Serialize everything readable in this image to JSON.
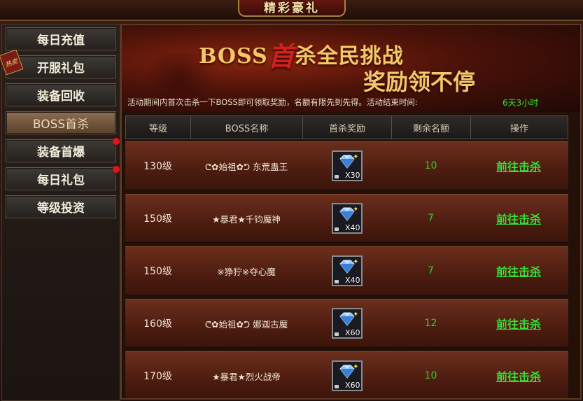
{
  "window": {
    "title": "精彩豪礼"
  },
  "sidebar": {
    "badge": "热卖",
    "items": [
      {
        "label": "每日充值",
        "active": false,
        "dot": false
      },
      {
        "label": "开服礼包",
        "active": false,
        "dot": false
      },
      {
        "label": "装备回收",
        "active": false,
        "dot": false
      },
      {
        "label": "BOSS首杀",
        "active": true,
        "dot": false
      },
      {
        "label": "装备首爆",
        "active": false,
        "dot": true
      },
      {
        "label": "每日礼包",
        "active": false,
        "dot": true
      },
      {
        "label": "等级投资",
        "active": false,
        "dot": false
      }
    ]
  },
  "banner": {
    "headline_a": "BOSS",
    "headline_big": "首",
    "headline_b": "杀全民挑战",
    "headline2": "奖励领不停",
    "notice": "活动期间内首次击杀一下BOSS即可领取奖励，名额有限先到先得。活动结束时间:",
    "time_left": "6天3小时"
  },
  "table": {
    "headers": [
      "等级",
      "BOSS名称",
      "首杀奖励",
      "剩余名额",
      "操作"
    ],
    "rows": [
      {
        "level": "130级",
        "boss": "ᕦ✿始祖✿ᕤ 东荒蛊王",
        "qty": "X30",
        "remaining": "10",
        "action": "前往击杀"
      },
      {
        "level": "150级",
        "boss": "★暴君★千钧魔神",
        "qty": "X40",
        "remaining": "7",
        "action": "前往击杀"
      },
      {
        "level": "150级",
        "boss": "※狰狞※夺心魔",
        "qty": "X40",
        "remaining": "7",
        "action": "前往击杀"
      },
      {
        "level": "160级",
        "boss": "ᕦ✿始祖✿ᕤ 娜迦古魔",
        "qty": "X60",
        "remaining": "12",
        "action": "前往击杀"
      },
      {
        "level": "170级",
        "boss": "★暴君★烈火战帝",
        "qty": "X60",
        "remaining": "10",
        "action": "前往击杀"
      }
    ]
  },
  "icons": {
    "reward": "diamond-icon",
    "lock": "lock-icon",
    "sparkle": "sparkle-icon"
  },
  "colors": {
    "accent_green": "#31e331",
    "gold": "#f3c869",
    "red": "#d71e1e"
  }
}
